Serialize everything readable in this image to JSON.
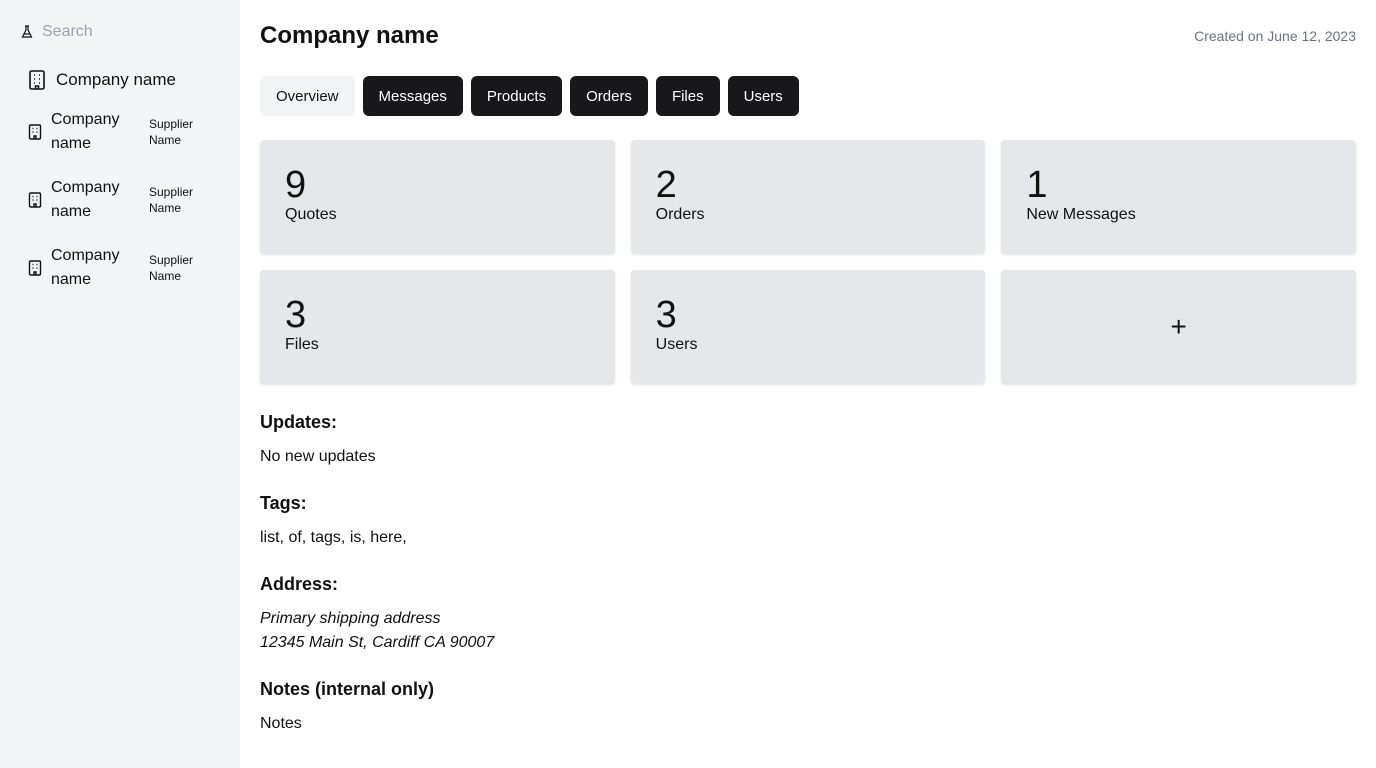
{
  "sidebar": {
    "search_placeholder": "Search",
    "main_company": "Company name",
    "items": [
      {
        "company": "Company name",
        "supplier": "Supplier Name"
      },
      {
        "company": "Company name",
        "supplier": "Supplier Name"
      },
      {
        "company": "Company name",
        "supplier": "Supplier Name"
      }
    ]
  },
  "header": {
    "title": "Company name",
    "created": "Created on June 12, 2023"
  },
  "tabs": [
    "Overview",
    "Messages",
    "Products",
    "Orders",
    "Files",
    "Users"
  ],
  "active_tab": "Overview",
  "cards": [
    {
      "count": "9",
      "label": "Quotes"
    },
    {
      "count": "2",
      "label": "Orders"
    },
    {
      "count": "1",
      "label": "New Messages"
    },
    {
      "count": "3",
      "label": "Files"
    },
    {
      "count": "3",
      "label": "Users"
    }
  ],
  "add_card_symbol": "+",
  "updates": {
    "heading": "Updates:",
    "text": "No new updates"
  },
  "tags": {
    "heading": "Tags:",
    "text": "list, of, tags, is, here,"
  },
  "address": {
    "heading": "Address:",
    "label": "Primary shipping address",
    "line": "12345 Main St, Cardiff CA 90007"
  },
  "notes": {
    "heading": "Notes (internal only)",
    "text": "Notes"
  },
  "icons": {
    "search": "flask-icon",
    "company": "building-icon"
  },
  "colors": {
    "sidebar_bg": "#f3f4f6",
    "tab_dark": "#18181b",
    "card_bg": "#e5e7eb",
    "muted_text": "#6b7280"
  }
}
